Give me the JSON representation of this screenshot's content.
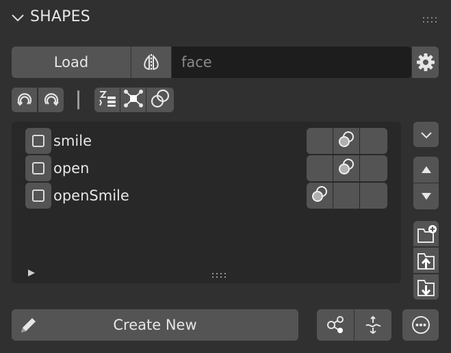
{
  "panel": {
    "title": "SHAPES"
  },
  "toolbar": {
    "load_label": "Load",
    "filter_value": "face"
  },
  "shapes": [
    {
      "name": "smile",
      "checked": false,
      "active_slot": 1
    },
    {
      "name": "open",
      "checked": false,
      "active_slot": 1
    },
    {
      "name": "openSmile",
      "checked": false,
      "active_slot": 0
    }
  ],
  "footer": {
    "create_label": "Create New"
  },
  "icons": {
    "header": [
      "chevron-down-icon",
      "drag-grip-icon"
    ],
    "row1": [
      "mirror-icon",
      "gear-icon"
    ],
    "tools": [
      "rotate-left-icon",
      "rotate-right-icon",
      "sort-list-icon",
      "nodes-icon",
      "overlap-circles-icon"
    ],
    "side": [
      "chevron-down-icon",
      "arrow-up-icon",
      "arrow-down-icon",
      "folder-add-icon",
      "folder-import-icon",
      "folder-export-icon"
    ],
    "bottom": [
      "pencil-icon",
      "node-link-icon",
      "bone-icon",
      "more-icon"
    ]
  },
  "colors": {
    "background": "#303030",
    "button": "#545454",
    "field": "#1d1d1d",
    "list": "#282828",
    "text": "#e6e6e6"
  }
}
